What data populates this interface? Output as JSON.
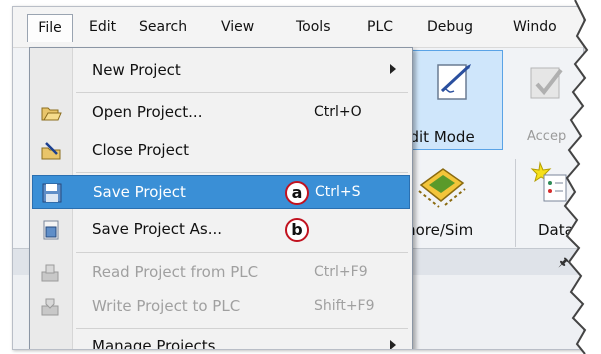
{
  "menubar": {
    "items": [
      "File",
      "Edit",
      "Search",
      "View",
      "Tools",
      "PLC",
      "Debug",
      "Windo"
    ]
  },
  "toolbar": {
    "edit_mode_label": "Edit Mode",
    "accept_label": "Accep",
    "sim_label": "more/Sim",
    "data_label": "Data"
  },
  "file_menu": {
    "new_project": "New Project",
    "open_project": "Open Project...",
    "open_shortcut": "Ctrl+O",
    "close_project": "Close Project",
    "save_project": "Save Project",
    "save_shortcut": "Ctrl+S",
    "save_project_as": "Save Project As...",
    "read_project": "Read Project from PLC",
    "read_shortcut": "Ctrl+F9",
    "write_project": "Write Project to PLC",
    "write_shortcut": "Shift+F9",
    "manage_projects": "Manage Projects"
  },
  "callouts": {
    "a": "a",
    "b": "b"
  },
  "colors": {
    "highlight": "#3a8fd6",
    "callout_ring": "#c1121f",
    "edit_mode_bg": "#cfe6fb"
  }
}
